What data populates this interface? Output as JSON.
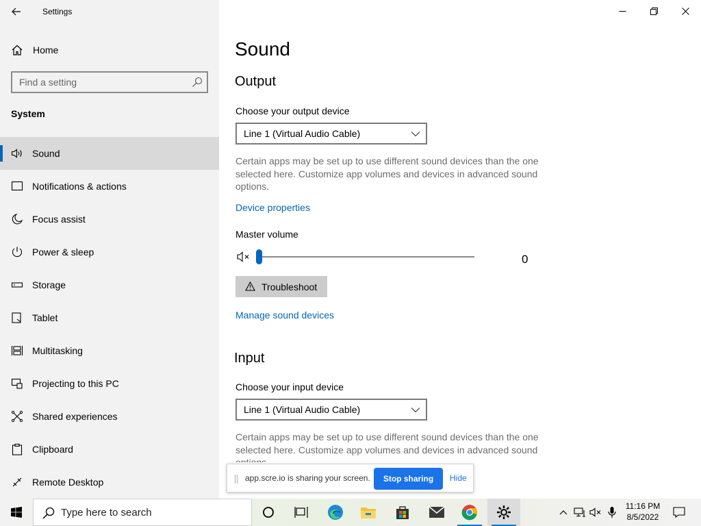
{
  "window": {
    "title": "Settings"
  },
  "sidebar": {
    "home_label": "Home",
    "search_placeholder": "Find a setting",
    "section_label": "System",
    "items": [
      {
        "label": "Sound",
        "icon": "speaker-icon",
        "active": true
      },
      {
        "label": "Notifications & actions",
        "icon": "notification-icon"
      },
      {
        "label": "Focus assist",
        "icon": "moon-icon"
      },
      {
        "label": "Power & sleep",
        "icon": "power-icon"
      },
      {
        "label": "Storage",
        "icon": "storage-icon"
      },
      {
        "label": "Tablet",
        "icon": "tablet-icon"
      },
      {
        "label": "Multitasking",
        "icon": "multitasking-icon"
      },
      {
        "label": "Projecting to this PC",
        "icon": "projecting-icon"
      },
      {
        "label": "Shared experiences",
        "icon": "shared-icon"
      },
      {
        "label": "Clipboard",
        "icon": "clipboard-icon"
      },
      {
        "label": "Remote Desktop",
        "icon": "remote-desktop-icon"
      }
    ]
  },
  "main": {
    "page_title": "Sound",
    "output": {
      "heading": "Output",
      "device_label": "Choose your output device",
      "device_value": "Line 1 (Virtual Audio Cable)",
      "description": "Certain apps may be set up to use different sound devices than the one selected here. Customize app volumes and devices in advanced sound options.",
      "device_properties_link": "Device properties",
      "master_volume_label": "Master volume",
      "volume_value": "0",
      "troubleshoot_label": "Troubleshoot",
      "manage_devices_link": "Manage sound devices"
    },
    "input": {
      "heading": "Input",
      "device_label": "Choose your input device",
      "device_value": "Line 1 (Virtual Audio Cable)",
      "description": "Certain apps may be set up to use different sound devices than the one selected here. Customize app volumes and devices in advanced sound options."
    }
  },
  "share_bar": {
    "message": "app.scre.io is sharing your screen.",
    "stop_label": "Stop sharing",
    "hide_label": "Hide"
  },
  "taskbar": {
    "search_placeholder": "Type here to search",
    "time": "11:16 PM",
    "date": "8/5/2022",
    "apps": [
      "cortana-icon",
      "task-view-icon",
      "edge-icon",
      "file-explorer-icon",
      "store-icon",
      "mail-icon",
      "chrome-icon",
      "settings-icon"
    ]
  },
  "colors": {
    "accent": "#0067c0",
    "link": "#0067b8",
    "sidebar_bg": "#f2f2f2",
    "active_item_bg": "#d9d9d9",
    "share_button": "#1a73e8"
  }
}
